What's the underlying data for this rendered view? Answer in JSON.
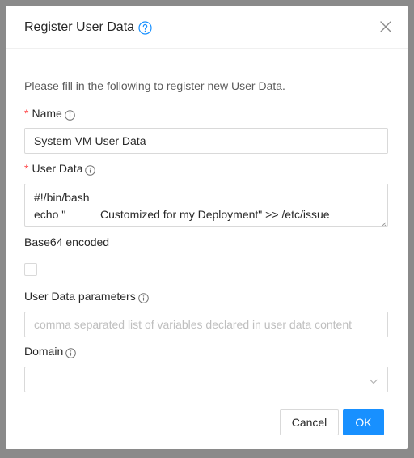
{
  "dialog": {
    "title": "Register User Data",
    "intro": "Please fill in the following to register new User Data."
  },
  "fields": {
    "name": {
      "label": "Name",
      "required_mark": "*",
      "value": "System VM User Data"
    },
    "userdata": {
      "label": "User Data",
      "required_mark": "*",
      "lines": [
        "#!/bin/bash",
        "echo \"           Customized for my Deployment\" >> /etc/issue"
      ]
    },
    "base64": {
      "label": "Base64 encoded",
      "checked": false
    },
    "params": {
      "label": "User Data parameters",
      "placeholder": "comma separated list of variables declared in user data content"
    },
    "domain": {
      "label": "Domain",
      "value": ""
    }
  },
  "footer": {
    "cancel_label": "Cancel",
    "ok_label": "OK"
  },
  "colors": {
    "primary": "#1890ff",
    "required": "#ff4d4f",
    "border": "#d9d9d9",
    "overlay": "#8a8a8a"
  },
  "icons": {
    "help": "question-circle-icon",
    "close": "close-icon",
    "info": "info-circle-icon",
    "chevron": "chevron-down-icon"
  }
}
